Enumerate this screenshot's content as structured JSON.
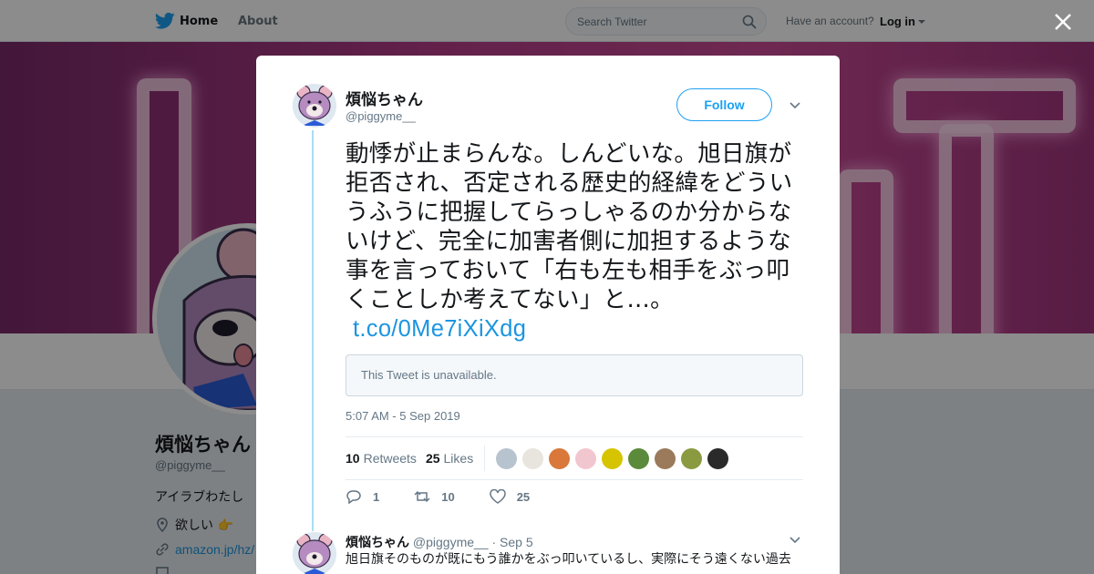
{
  "nav": {
    "home_label": "Home",
    "about_label": "About",
    "search_placeholder": "Search Twitter",
    "account_prompt": "Have an account?",
    "login_label": "Log in"
  },
  "profile": {
    "name": "煩悩ちゃん",
    "handle": "@piggyme__",
    "bio": "アイラブわたし",
    "location": "欲しい 👉",
    "link": "amazon.jp/hz/"
  },
  "tweet": {
    "author_name": "煩悩ちゃん",
    "author_handle": "@piggyme__",
    "follow_label": "Follow",
    "text": "動悸が止まらんな。しんどいな。旭日旗が拒否され、否定される歴史的経緯をどういうふうに把握してらっしゃるのか分からないけど、完全に加害者側に加担するような事を言っておいて「右も左も相手をぶっ叩くことしか考えてない」と…。",
    "link": "t.co/0Me7iXiXdg",
    "quoted_unavailable": "This Tweet is unavailable.",
    "timestamp": "5:07 AM - 5 Sep 2019",
    "retweets": "10",
    "retweets_label": "Retweets",
    "likes": "25",
    "likes_label": "Likes",
    "reply_count": "1",
    "retweet_count": "10",
    "like_count": "25",
    "liker_colors": [
      "#b7c4cf",
      "#e8e4de",
      "#d9783a",
      "#f2c6cf",
      "#d6c400",
      "#5a8a3a",
      "#9a7a5a",
      "#8a9a40",
      "#2a2a2a"
    ]
  },
  "reply": {
    "name": "煩悩ちゃん",
    "handle": "@piggyme__",
    "date": "· Sep 5",
    "text": "旭日旗そのものが既にもう誰かをぶっ叩いているし、実際にそう遠くない過去"
  },
  "colors": {
    "accent": "#1da1f2",
    "link": "#1b95e0",
    "thread": "#a9dcf6"
  }
}
